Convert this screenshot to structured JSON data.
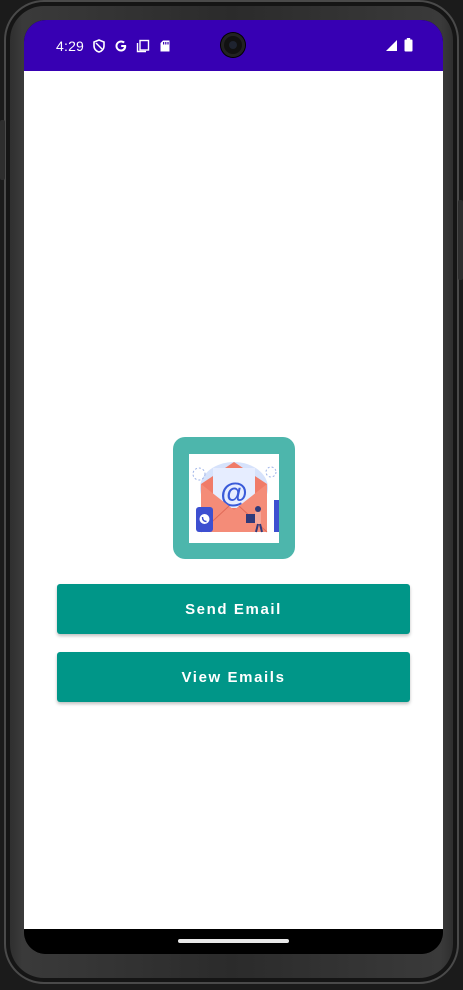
{
  "status_bar": {
    "time": "4:29",
    "background_color": "#3700b3",
    "left_icons": [
      "shield-icon",
      "google-icon",
      "copy-icon",
      "sd-card-icon"
    ],
    "right_icons": [
      "signal-icon",
      "battery-icon"
    ]
  },
  "app": {
    "background_color": "#ffffff",
    "logo": {
      "description_icon": "email-illustration-icon",
      "frame_color": "#4db6ac"
    },
    "buttons": {
      "send_email_label": "Send Email",
      "view_emails_label": "View Emails",
      "color": "#009688"
    }
  }
}
